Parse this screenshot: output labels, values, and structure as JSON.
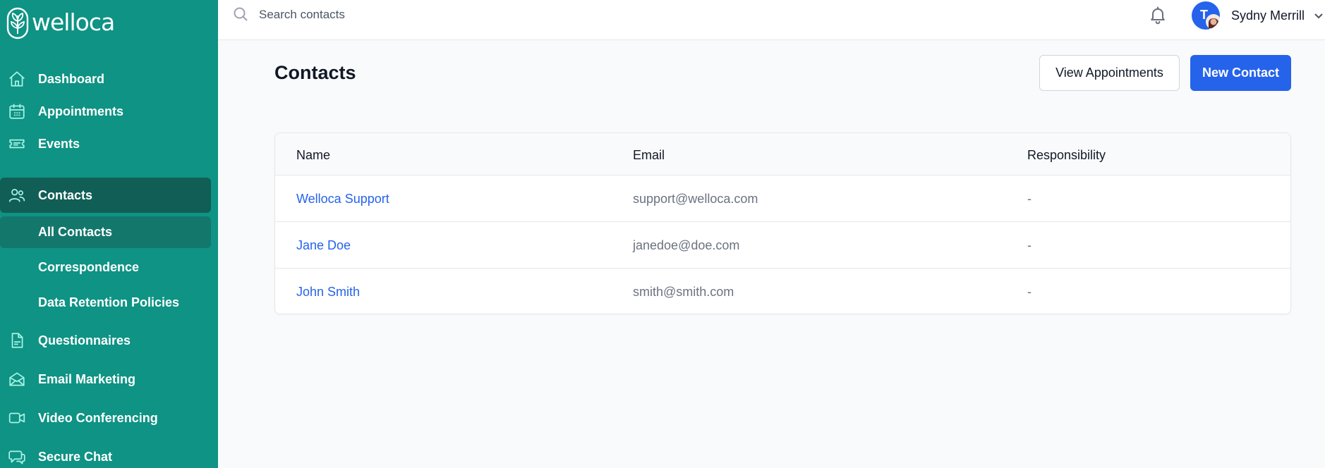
{
  "brand": {
    "name": "welloca"
  },
  "sidebar": {
    "items": [
      {
        "label": "Dashboard",
        "icon": "home-icon"
      },
      {
        "label": "Appointments",
        "icon": "calendar-icon"
      },
      {
        "label": "Events",
        "icon": "ticket-icon"
      },
      {
        "label": "Contacts",
        "icon": "users-icon",
        "active": true
      },
      {
        "label": "Questionnaires",
        "icon": "document-icon"
      },
      {
        "label": "Email Marketing",
        "icon": "envelope-icon"
      },
      {
        "label": "Video Conferencing",
        "icon": "video-icon"
      },
      {
        "label": "Secure Chat",
        "icon": "chat-icon"
      }
    ],
    "contacts_sub": [
      {
        "label": "All Contacts",
        "active": true
      },
      {
        "label": "Correspondence"
      },
      {
        "label": "Data Retention Policies"
      }
    ]
  },
  "topbar": {
    "search_placeholder": "Search contacts",
    "user": {
      "name": "Sydny Merrill",
      "initial": "T"
    }
  },
  "main": {
    "title": "Contacts",
    "view_appointments_label": "View Appointments",
    "new_contact_label": "New Contact"
  },
  "table": {
    "headers": {
      "name": "Name",
      "email": "Email",
      "responsibility": "Responsibility"
    },
    "rows": [
      {
        "name": "Welloca Support",
        "email": "support@welloca.com",
        "responsibility": "-"
      },
      {
        "name": "Jane Doe",
        "email": "janedoe@doe.com",
        "responsibility": "-"
      },
      {
        "name": "John Smith",
        "email": "smith@smith.com",
        "responsibility": "-"
      }
    ]
  },
  "colors": {
    "sidebar_bg": "#0e9384",
    "sidebar_active": "#115e56",
    "primary": "#2563eb",
    "link": "#2563eb"
  }
}
